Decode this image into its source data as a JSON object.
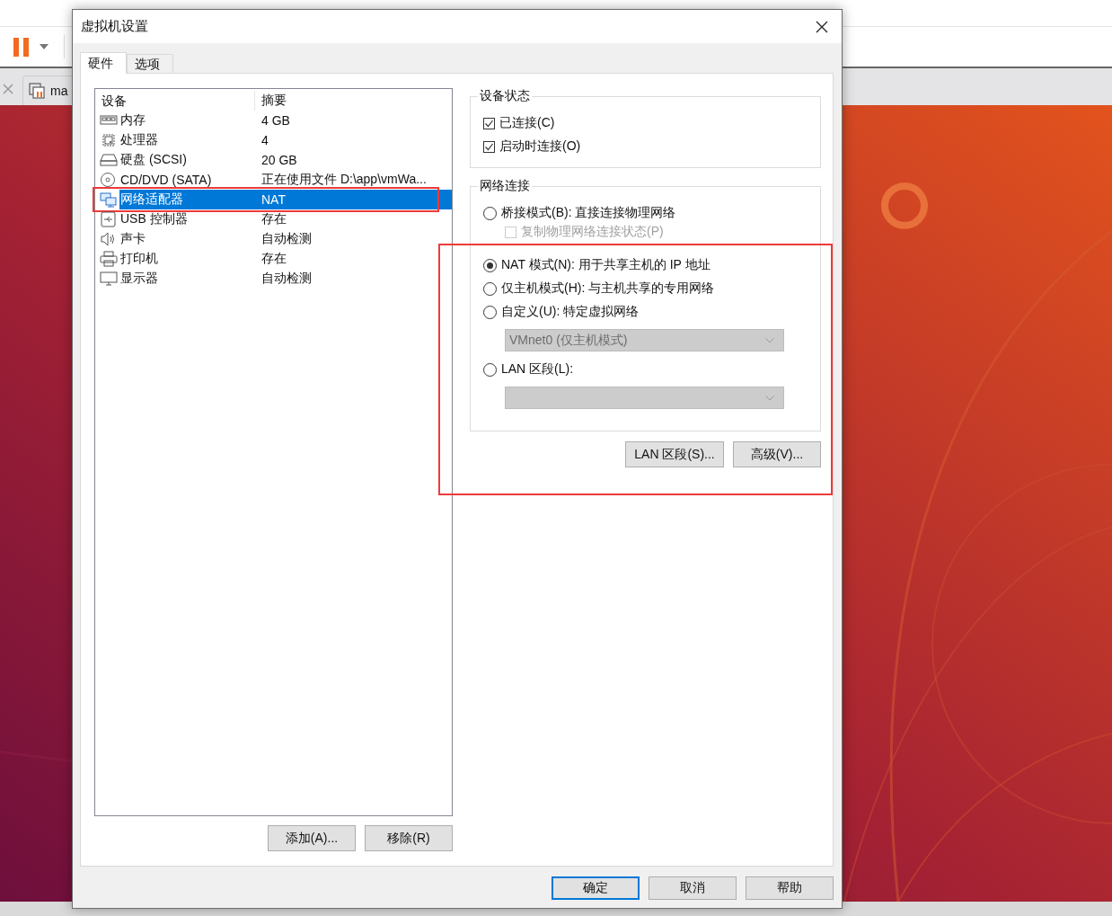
{
  "background_app": {
    "tab": {
      "label": "ma"
    }
  },
  "dialog": {
    "title": "虚拟机设置",
    "tabs": [
      {
        "label": "硬件",
        "selected": true
      },
      {
        "label": "选项",
        "selected": false
      }
    ],
    "devices": {
      "columns": [
        "设备",
        "摘要"
      ],
      "rows": [
        {
          "kind": "memory",
          "name": "内存",
          "summary": "4 GB",
          "selected": false,
          "highlighted": false
        },
        {
          "kind": "cpu",
          "name": "处理器",
          "summary": "4",
          "selected": false,
          "highlighted": false
        },
        {
          "kind": "disk",
          "name": "硬盘 (SCSI)",
          "summary": "20 GB",
          "selected": false,
          "highlighted": false
        },
        {
          "kind": "cdrom",
          "name": "CD/DVD (SATA)",
          "summary": "正在使用文件 D:\\app\\vmWa...",
          "selected": false,
          "highlighted": false
        },
        {
          "kind": "network",
          "name": "网络适配器",
          "summary": "NAT",
          "selected": true,
          "highlighted": true
        },
        {
          "kind": "usb",
          "name": "USB 控制器",
          "summary": "存在",
          "selected": false,
          "highlighted": false
        },
        {
          "kind": "sound",
          "name": "声卡",
          "summary": "自动检测",
          "selected": false,
          "highlighted": false
        },
        {
          "kind": "printer",
          "name": "打印机",
          "summary": "存在",
          "selected": false,
          "highlighted": false
        },
        {
          "kind": "display",
          "name": "显示器",
          "summary": "自动检测",
          "selected": false,
          "highlighted": false
        }
      ]
    },
    "list_buttons": [
      "添加(A)...",
      "移除(R)"
    ],
    "device_status": {
      "title": "设备状态",
      "options": [
        {
          "label": "已连接(C)",
          "checked": true
        },
        {
          "label": "启动时连接(O)",
          "checked": true
        }
      ]
    },
    "network": {
      "title": "网络连接",
      "highlighted": true,
      "modes": [
        {
          "label": "桥接模式(B): 直接连接物理网络",
          "selected": false,
          "sub": {
            "label": "复制物理网络连接状态(P)",
            "checked": false,
            "disabled": true
          }
        },
        {
          "label": "NAT 模式(N): 用于共享主机的 IP 地址",
          "selected": true
        },
        {
          "label": "仅主机模式(H): 与主机共享的专用网络",
          "selected": false
        },
        {
          "label": "自定义(U): 特定虚拟网络",
          "selected": false,
          "dropdown": {
            "value": "VMnet0 (仅主机模式)",
            "disabled": true
          }
        },
        {
          "label": "LAN 区段(L):",
          "selected": false,
          "dropdown": {
            "disabled": true
          }
        }
      ],
      "buttons": [
        "LAN 区段(S)...",
        "高级(V)..."
      ]
    },
    "footer_buttons": [
      {
        "label": "确定",
        "default": true
      },
      {
        "label": "取消",
        "default": false
      },
      {
        "label": "帮助",
        "default": false
      }
    ]
  }
}
